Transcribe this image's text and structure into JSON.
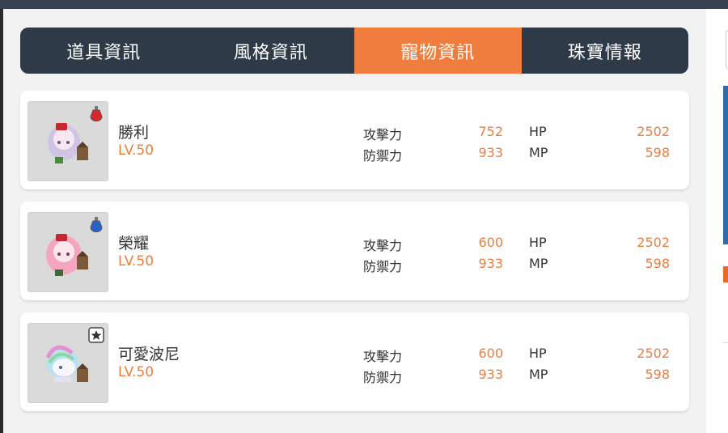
{
  "tabs": [
    {
      "label": "道具資訊",
      "active": false
    },
    {
      "label": "風格資訊",
      "active": false
    },
    {
      "label": "寵物資訊",
      "active": true
    },
    {
      "label": "珠寶情報",
      "active": false
    }
  ],
  "stat_labels": {
    "attack": "攻擊力",
    "defense": "防禦力",
    "hp": "HP",
    "mp": "MP"
  },
  "pets": [
    {
      "name": "勝利",
      "level": "LV.50",
      "attack": "752",
      "defense": "933",
      "hp": "2502",
      "mp": "598",
      "badge": "red-potion-icon"
    },
    {
      "name": "榮耀",
      "level": "LV.50",
      "attack": "600",
      "defense": "933",
      "hp": "2502",
      "mp": "598",
      "badge": "blue-potion-icon"
    },
    {
      "name": "可愛波尼",
      "level": "LV.50",
      "attack": "600",
      "defense": "933",
      "hp": "2502",
      "mp": "598",
      "badge": "star-box-icon"
    }
  ],
  "colors": {
    "accent": "#f07c3d",
    "tab_bg": "#2e3a48",
    "topbar": "#37414f"
  }
}
